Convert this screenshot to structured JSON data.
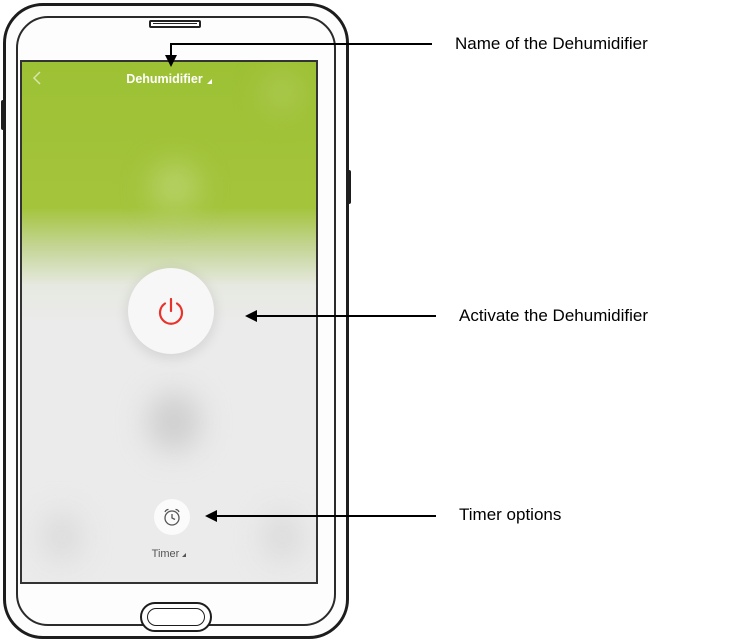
{
  "app": {
    "title": "Dehumidifier",
    "back_icon": "chevron-left-icon",
    "power_icon": "power-icon",
    "timer_icon": "alarm-clock-icon",
    "timer_label": "Timer",
    "colors": {
      "header_green": "#9dc134",
      "power_red": "#e8322c",
      "screen_background": "#ebebeb"
    }
  },
  "annotations": {
    "name": "Name of the Dehumidifier",
    "activate": "Activate the Dehumidifier",
    "timer": "Timer options"
  }
}
